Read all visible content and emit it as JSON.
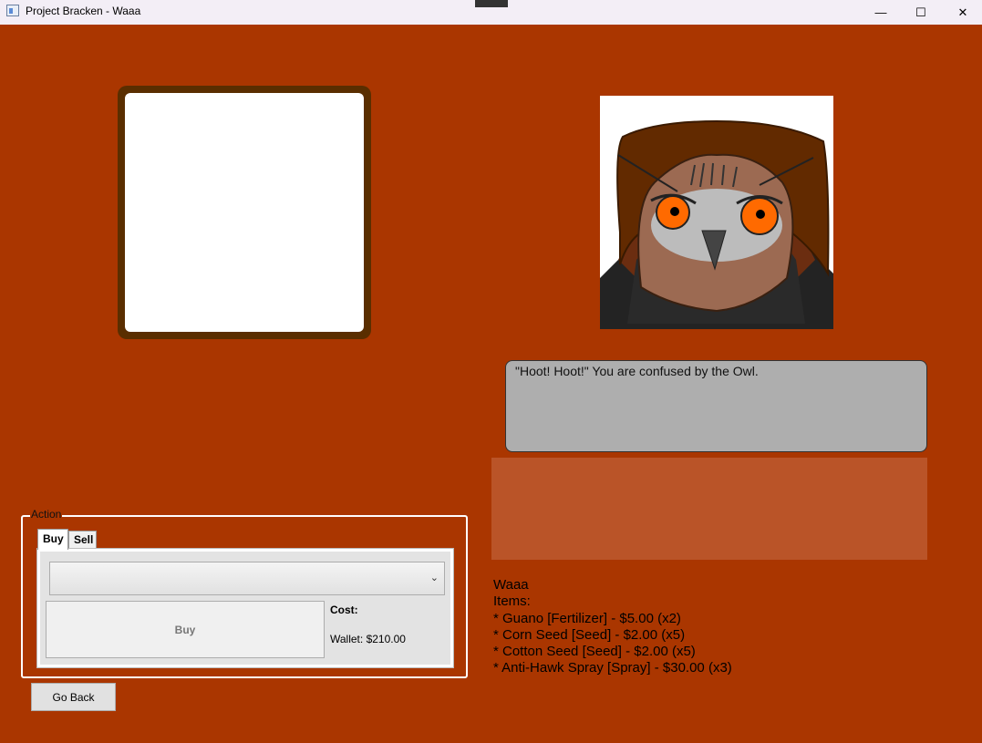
{
  "window": {
    "title": "Project Bracken - Waaa",
    "minimize_glyph": "—",
    "maximize_glyph": "☐",
    "close_glyph": "✕"
  },
  "dialog": {
    "text": "\"Hoot! Hoot!\" You are confused by the Owl."
  },
  "info": {
    "name": "Waaa",
    "items_label": "Items:",
    "items": [
      "* Guano [Fertilizer] - $5.00 (x2)",
      "* Corn Seed [Seed] - $2.00 (x5)",
      "* Cotton Seed [Seed] - $2.00 (x5)",
      "* Anti-Hawk Spray [Spray] - $30.00 (x3)"
    ]
  },
  "action": {
    "legend": "Action",
    "tabs": [
      "Buy",
      "Sell"
    ],
    "selected_item": "",
    "buy_label": "Buy",
    "cost_label": "Cost:",
    "wallet_text": "Wallet: $210.00"
  },
  "go_back_label": "Go Back",
  "colors": {
    "background": "#aa3600",
    "frame": "#5a2e00",
    "dialog": "#aeaeae",
    "choice_panel": "#ba5428"
  },
  "icons": {
    "app": "app-window-icon",
    "dropdown": "chevron-down-icon"
  }
}
